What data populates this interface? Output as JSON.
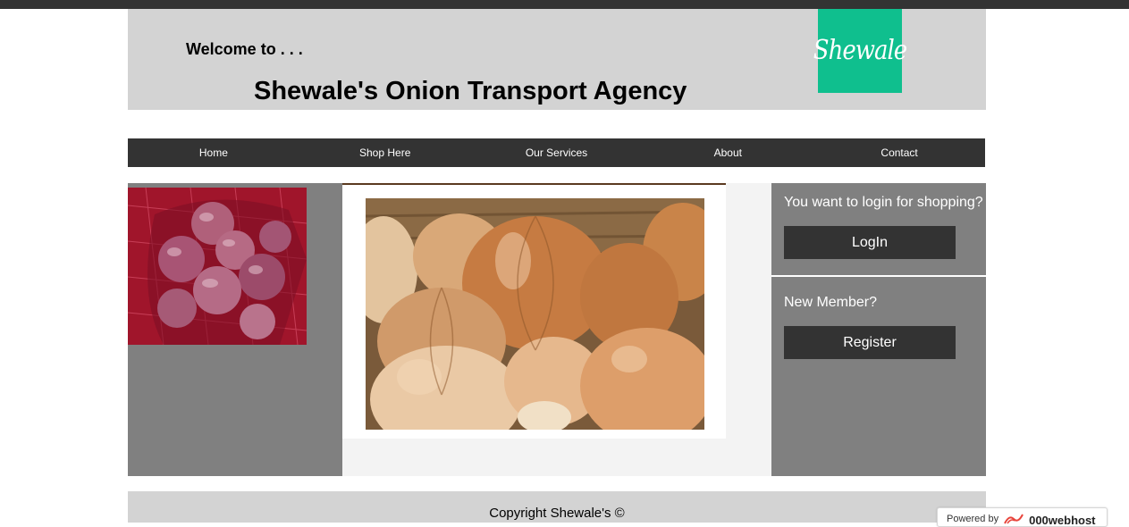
{
  "header": {
    "welcome": "Welcome to . . .",
    "title": "Shewale's Onion Transport Agency",
    "logo_text": "Shewale",
    "logo_color": "#0fbf8e"
  },
  "nav": {
    "items": [
      "Home",
      "Shop Here",
      "Our Services",
      "About",
      "Contact"
    ]
  },
  "sidebar": {
    "login_prompt": "You want to login for shopping?",
    "login_button": "LogIn",
    "register_prompt": "New Member?",
    "register_button": "Register"
  },
  "footer": {
    "copyright": "Copyright Shewale's ©"
  },
  "badge": {
    "prefix": "Powered by",
    "brand": "000webhost"
  },
  "icons": {
    "photo_left": "red-onions-photo",
    "photo_main": "brown-onions-photo",
    "badge_logo": "000webhost-logo-icon"
  }
}
